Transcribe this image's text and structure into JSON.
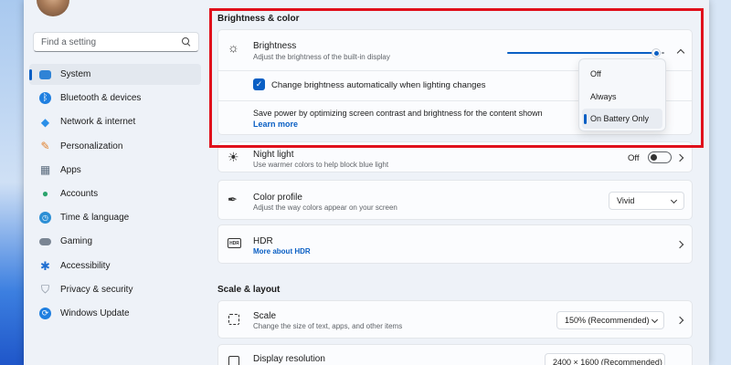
{
  "search": {
    "placeholder": "Find a setting"
  },
  "sidebar": {
    "items": [
      {
        "label": "System",
        "icon": "system-icon",
        "color": "#2f83d6",
        "active": true
      },
      {
        "label": "Bluetooth & devices",
        "icon": "bluetooth-icon",
        "color": "#1f7fe0"
      },
      {
        "label": "Network & internet",
        "icon": "wifi-icon",
        "color": "#2a8fe8"
      },
      {
        "label": "Personalization",
        "icon": "brush-icon",
        "color": "#e0822f"
      },
      {
        "label": "Apps",
        "icon": "apps-icon",
        "color": "#5a6b7d"
      },
      {
        "label": "Accounts",
        "icon": "accounts-icon",
        "color": "#2ba36d"
      },
      {
        "label": "Time & language",
        "icon": "globe-clock-icon",
        "color": "#2d8fd5"
      },
      {
        "label": "Gaming",
        "icon": "controller-icon",
        "color": "#7a8593"
      },
      {
        "label": "Accessibility",
        "icon": "accessibility-icon",
        "color": "#1f6fd1"
      },
      {
        "label": "Privacy & security",
        "icon": "shield-icon",
        "color": "#7a8593"
      },
      {
        "label": "Windows Update",
        "icon": "update-icon",
        "color": "#1f7fe0"
      }
    ]
  },
  "sections": {
    "brightness_color": "Brightness & color",
    "scale_layout": "Scale & layout"
  },
  "brightness": {
    "title": "Brightness",
    "desc": "Adjust the brightness of the built-in display",
    "level": 0.95,
    "auto_label": "Change brightness automatically when lighting changes",
    "auto_checked": true,
    "save_power_text": "Save power by optimizing screen contrast and brightness for the content shown",
    "learn_more": "Learn more"
  },
  "content_adaptive_menu": {
    "options": [
      "Off",
      "Always",
      "On Battery Only"
    ],
    "selected": "On Battery Only"
  },
  "night_light": {
    "title": "Night light",
    "desc": "Use warmer colors to help block blue light",
    "state_label": "Off",
    "on": false
  },
  "color_profile": {
    "title": "Color profile",
    "desc": "Adjust the way colors appear on your screen",
    "value": "Vivid"
  },
  "hdr": {
    "title": "HDR",
    "icon_text": "HDR",
    "link": "More about HDR"
  },
  "scale": {
    "title": "Scale",
    "desc": "Change the size of text, apps, and other items",
    "value": "150% (Recommended)"
  },
  "display_resolution": {
    "title": "Display resolution",
    "value": "2400 × 1600 (Recommended)"
  },
  "colors": {
    "accent": "#0a5fc4",
    "highlight_box": "#e0101b"
  }
}
